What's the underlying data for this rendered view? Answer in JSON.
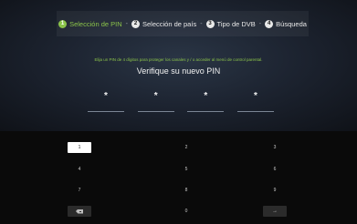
{
  "steps": [
    {
      "num": "1",
      "label": "Selección de PIN"
    },
    {
      "num": "2",
      "label": "Selección de país"
    },
    {
      "num": "3",
      "label": "Tipo de DVB"
    },
    {
      "num": "4",
      "label": "Búsqueda"
    }
  ],
  "separator": "-",
  "hint": "Elija un PIN de 4 dígitos para proteger los canales y / o acceder al menú de control parental.",
  "title": "Verifique su nuevo PIN",
  "pin": [
    "*",
    "*",
    "*",
    "*"
  ],
  "keypad": {
    "keys": [
      "1",
      "2",
      "3",
      "4",
      "5",
      "6",
      "7",
      "8",
      "9",
      "0"
    ],
    "backspace_icon": "backspace-icon",
    "enter_icon": "arrow-right-icon",
    "arrow_glyph": "→"
  },
  "colors": {
    "accent": "#8bc34a",
    "focused_key_bg": "#ffffff",
    "dark_key_bg": "#2b2b2b"
  }
}
